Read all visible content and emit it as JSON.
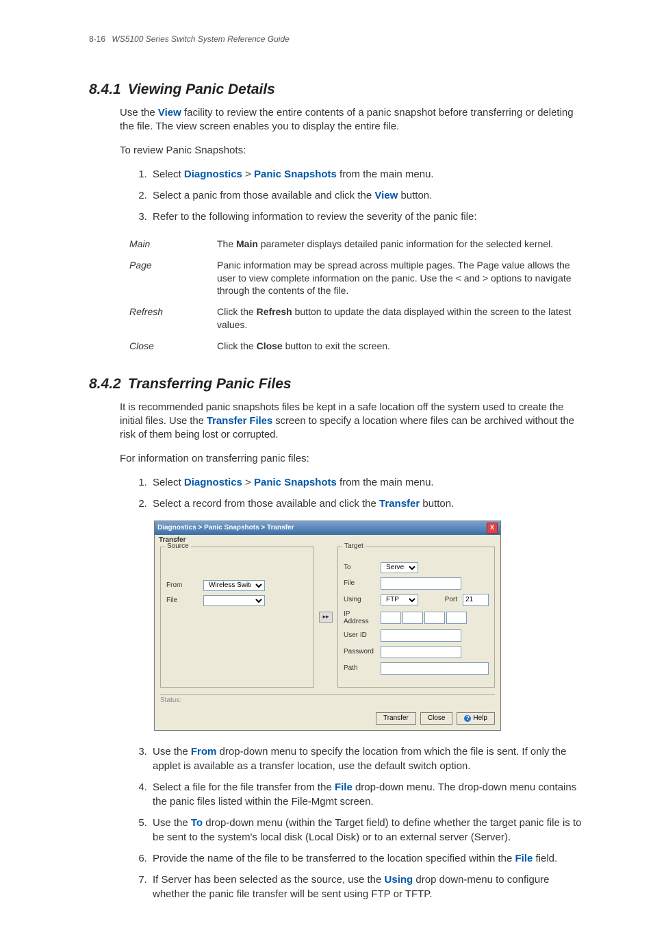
{
  "header": {
    "pagenum": "8-16",
    "guide": "WS5100 Series Switch System Reference Guide"
  },
  "sec1": {
    "num": "8.4.1",
    "title": "Viewing Panic Details",
    "intro_pre": "Use the ",
    "intro_kw": "View",
    "intro_post": " facility to review the entire contents of a panic snapshot before transferring or deleting the file. The view screen enables you to display the entire file.",
    "lead": "To review Panic Snapshots:",
    "li1_a": "Select ",
    "li1_kw1": "Diagnostics",
    "li1_b": " > ",
    "li1_kw2": "Panic Snapshots",
    "li1_c": " from the main menu.",
    "li2_a": "Select a panic from those available and click the ",
    "li2_kw": "View",
    "li2_b": " button.",
    "li3": "Refer to the following information to review the severity of the panic file:",
    "defs": {
      "main_t": "Main",
      "main_a": "The ",
      "main_bld": "Main",
      "main_b": " parameter displays detailed panic information for the selected kernel.",
      "page_t": "Page",
      "page_d": "Panic information may be spread across multiple pages. The Page value allows the user to view complete information on the panic. Use the < and > options to navigate through the contents of the file.",
      "refresh_t": "Refresh",
      "refresh_a": "Click the ",
      "refresh_bld": "Refresh",
      "refresh_b": " button to update the data displayed within the screen to the latest values.",
      "close_t": "Close",
      "close_a": "Click the ",
      "close_bld": "Close",
      "close_b": " button to exit the screen."
    }
  },
  "sec2": {
    "num": "8.4.2",
    "title": "Transferring Panic Files",
    "intro_a": "It is recommended panic snapshots files be kept in a safe location off the system used to create the initial files. Use the ",
    "intro_kw": "Transfer Files",
    "intro_b": " screen to specify a location where files can be archived without the risk of them being lost or corrupted.",
    "lead": "For information on transferring panic files:",
    "li1_a": "Select ",
    "li1_kw1": "Diagnostics",
    "li1_b": " > ",
    "li1_kw2": "Panic Snapshots",
    "li1_c": " from the main menu.",
    "li2_a": "Select a record from those available and click the ",
    "li2_kw": "Transfer",
    "li2_b": " button.",
    "li3_a": "Use the ",
    "li3_kw": "From",
    "li3_b": " drop-down menu to specify the location from which the file is sent. If only the applet is available as a transfer location, use the default switch option.",
    "li4_a": "Select a file for the file transfer from the ",
    "li4_kw": "File",
    "li4_b": " drop-down menu. The drop-down menu contains the panic files listed within the File-Mgmt screen.",
    "li5_a": "Use the ",
    "li5_kw": "To",
    "li5_b": " drop-down menu (within the Target field) to define whether the target panic file is to be sent to the system's local disk (Local Disk) or to an external server (Server).",
    "li6_a": "Provide the name of the file to be transferred to the location specified within the ",
    "li6_kw": "File",
    "li6_b": " field.",
    "li7_a": "If Server has been selected as the source, use the ",
    "li7_kw": "Using",
    "li7_b": " drop down-menu to configure whether the panic file transfer will be sent using FTP or TFTP."
  },
  "dialog": {
    "breadcrumb": "Diagnostics > Panic Snapshots > Transfer",
    "tab": "Transfer",
    "close_x": "X",
    "source": "Source",
    "target": "Target",
    "from_lbl": "From",
    "from_val": "Wireless Switch",
    "file_lbl": "File",
    "to_lbl": "To",
    "to_val": "Server",
    "using_lbl": "Using",
    "using_val": "FTP",
    "port_lbl": "Port",
    "port_val": "21",
    "ip_lbl": "IP Address",
    "user_lbl": "User ID",
    "pass_lbl": "Password",
    "path_lbl": "Path",
    "status": "Status:",
    "arrow": "▸▸",
    "btn_transfer": "Transfer",
    "btn_close": "Close",
    "btn_help": "Help",
    "help_q": "?"
  }
}
